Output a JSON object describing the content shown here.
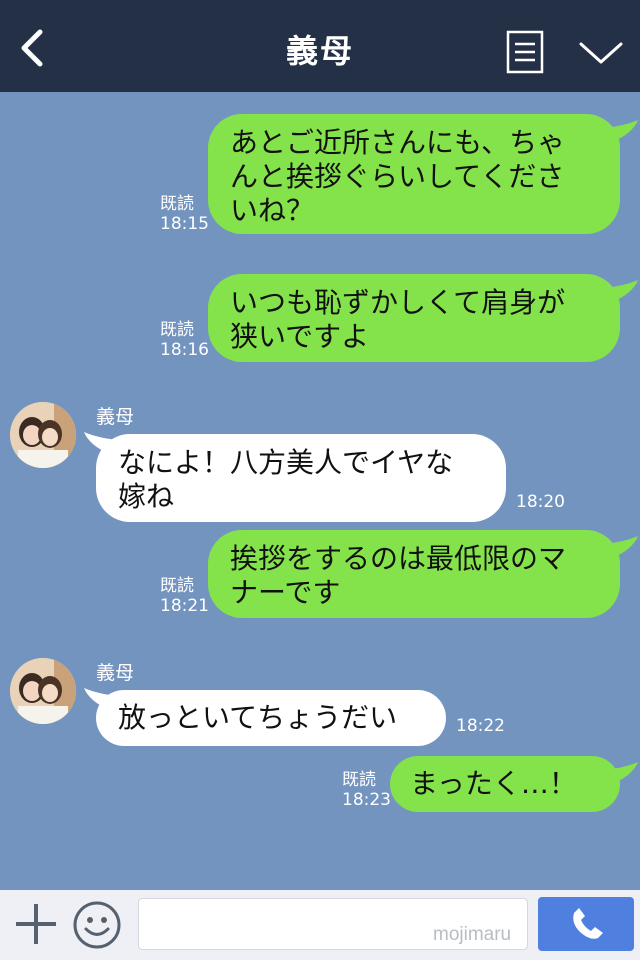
{
  "header": {
    "title": "義母",
    "back_icon": "chevron-left-icon",
    "menu_icon": "menu-list-icon",
    "collapse_icon": "chevron-down-icon"
  },
  "colors": {
    "header_bg": "#243046",
    "chat_bg": "#7494c0",
    "outgoing_bubble": "#84e34a",
    "incoming_bubble": "#ffffff",
    "call_button": "#4f80e0"
  },
  "messages": [
    {
      "direction": "out",
      "lines": [
        "あとご近所さんにも、ちゃ",
        "んと挨拶ぐらいしてくださ",
        "いね？"
      ],
      "read": "既読",
      "time": "18:15"
    },
    {
      "direction": "out",
      "lines": [
        "いつも恥ずかしくて肩身が",
        "狭いですよ"
      ],
      "read": "既読",
      "time": "18:16"
    },
    {
      "direction": "in",
      "sender": "義母",
      "lines": [
        "なによ！八方美人でイヤな",
        "嫁ね"
      ],
      "time": "18:20"
    },
    {
      "direction": "out",
      "lines": [
        "挨拶をするのは最低限のマ",
        "ナーです"
      ],
      "read": "既読",
      "time": "18:21"
    },
    {
      "direction": "in",
      "sender": "義母",
      "lines": [
        "放っといてちょうだい"
      ],
      "time": "18:22"
    },
    {
      "direction": "out",
      "lines": [
        "まったく…！"
      ],
      "read": "既読",
      "time": "18:23"
    }
  ],
  "footer": {
    "plus_icon": "plus-icon",
    "sticker_icon": "smiley-icon",
    "input_value": "",
    "watermark": "mojimaru",
    "call_icon": "phone-icon"
  }
}
